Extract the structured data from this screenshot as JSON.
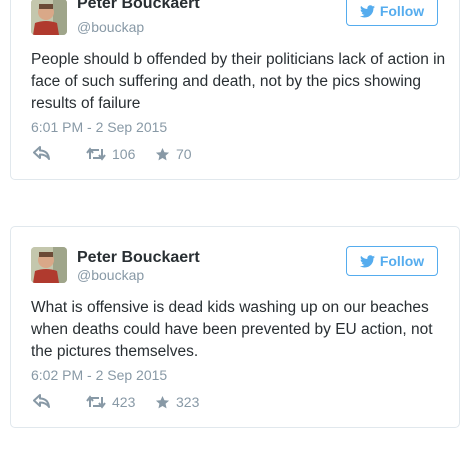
{
  "tweets": [
    {
      "author_name": "Peter Bouckaert",
      "author_handle": "@bouckap",
      "follow_label": "Follow",
      "text": "People should b offended by their politicians lack of action in face of such suffering and death, not by the pics showing results of failure",
      "timestamp": "6:01 PM - 2 Sep 2015",
      "retweets": "106",
      "likes": "70"
    },
    {
      "author_name": "Peter Bouckaert",
      "author_handle": "@bouckap",
      "follow_label": "Follow",
      "text": "What is offensive is dead kids washing up on our beaches when deaths could have been prevented by EU action, not the pictures themselves.",
      "timestamp": "6:02 PM - 2 Sep 2015",
      "retweets": "423",
      "likes": "323"
    }
  ],
  "icons": {
    "reply": "reply-icon",
    "retweet": "retweet-icon",
    "like": "star-icon",
    "follow": "twitter-bird-icon"
  },
  "colors": {
    "accent": "#55acee",
    "muted": "#8899a6",
    "text": "#292f33",
    "border": "#e1e8ed"
  }
}
